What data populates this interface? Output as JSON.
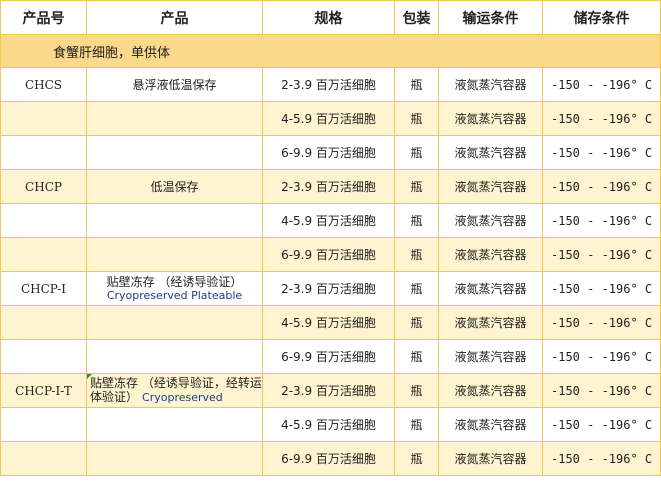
{
  "headers": [
    "产品号",
    "产品",
    "规格",
    "包装",
    "输运条件",
    "储存条件"
  ],
  "group_title": "食蟹肝细胞，单供体",
  "rows": [
    {
      "code": "CHCS",
      "product": "悬浮液低温保存",
      "sub": "",
      "spec": "2-3.9 百万活细胞",
      "pack": "瓶",
      "transport": "液氮蒸汽容器",
      "storage": "-150 - -196° C"
    },
    {
      "code": "",
      "product": "",
      "sub": "",
      "spec": "4-5.9 百万活细胞",
      "pack": "瓶",
      "transport": "液氮蒸汽容器",
      "storage": "-150 - -196° C"
    },
    {
      "code": "",
      "product": "",
      "sub": "",
      "spec": "6-9.9 百万活细胞",
      "pack": "瓶",
      "transport": "液氮蒸汽容器",
      "storage": "-150 - -196° C"
    },
    {
      "code": "CHCP",
      "product": "低温保存",
      "sub": "",
      "spec": "2-3.9 百万活细胞",
      "pack": "瓶",
      "transport": "液氮蒸汽容器",
      "storage": "-150 - -196° C"
    },
    {
      "code": "",
      "product": "",
      "sub": "",
      "spec": "4-5.9 百万活细胞",
      "pack": "瓶",
      "transport": "液氮蒸汽容器",
      "storage": "-150 - -196° C"
    },
    {
      "code": "",
      "product": "",
      "sub": "",
      "spec": "6-9.9 百万活细胞",
      "pack": "瓶",
      "transport": "液氮蒸汽容器",
      "storage": "-150 - -196° C"
    },
    {
      "code": "CHCP-I",
      "product": "贴壁冻存 （经诱导验证）",
      "sub": "Cryopreserved Plateable",
      "spec": "2-3.9 百万活细胞",
      "pack": "瓶",
      "transport": "液氮蒸汽容器",
      "storage": "-150 - -196° C"
    },
    {
      "code": "",
      "product": "",
      "sub": "",
      "spec": "4-5.9 百万活细胞",
      "pack": "瓶",
      "transport": "液氮蒸汽容器",
      "storage": "-150 - -196° C"
    },
    {
      "code": "",
      "product": "",
      "sub": "",
      "spec": "6-9.9 百万活细胞",
      "pack": "瓶",
      "transport": "液氮蒸汽容器",
      "storage": "-150 - -196° C"
    },
    {
      "code": "CHCP-I-T",
      "product": "贴壁冻存 （经诱导验证，经转运体验证）",
      "sub": "Cryopreserved",
      "spec": "2-3.9 百万活细胞",
      "pack": "瓶",
      "transport": "液氮蒸汽容器",
      "storage": "-150 - -196° C"
    },
    {
      "code": "",
      "product": "",
      "sub": "",
      "spec": "4-5.9 百万活细胞",
      "pack": "瓶",
      "transport": "液氮蒸汽容器",
      "storage": "-150 - -196° C"
    },
    {
      "code": "",
      "product": "",
      "sub": "",
      "spec": "6-9.9 百万活细胞",
      "pack": "瓶",
      "transport": "液氮蒸汽容器",
      "storage": "-150 - -196° C"
    }
  ]
}
